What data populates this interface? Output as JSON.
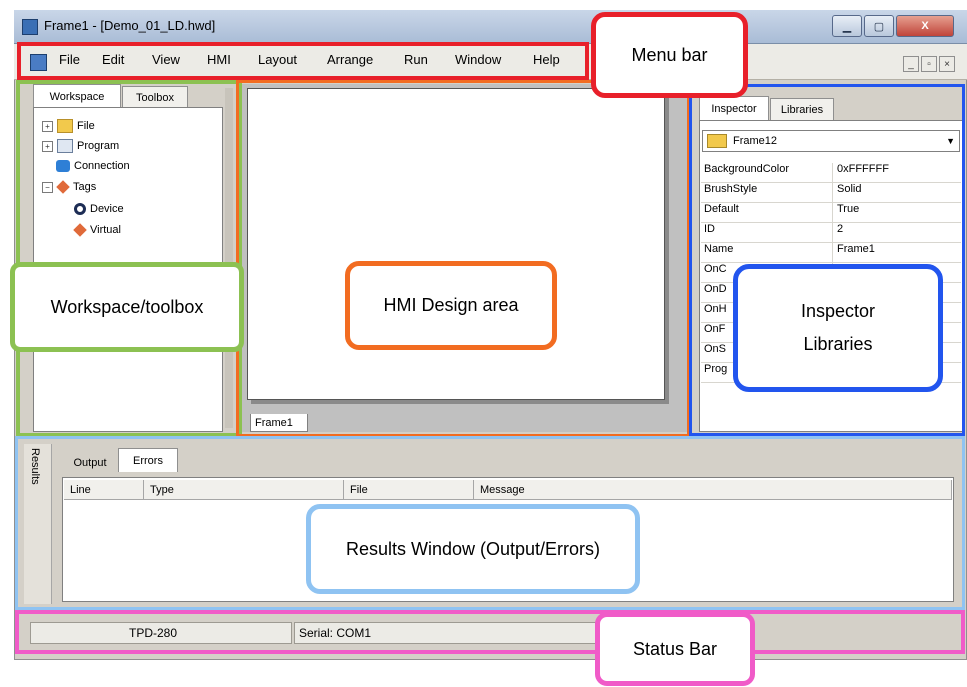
{
  "window": {
    "title": "Frame1 - [Demo_01_LD.hwd]",
    "controls": [
      "▁",
      "▢",
      "X"
    ],
    "mdi_controls": [
      "_",
      "▫",
      "×"
    ]
  },
  "menu": {
    "items": [
      "File",
      "Edit",
      "View",
      "HMI",
      "Layout",
      "Arrange",
      "Run",
      "Window",
      "Help"
    ]
  },
  "workspace": {
    "tabs": [
      "Workspace",
      "Toolbox"
    ],
    "tree": [
      {
        "label": "File",
        "icon": "folder-icon",
        "exp": "+"
      },
      {
        "label": "Program",
        "icon": "program-icon",
        "exp": "+"
      },
      {
        "label": "Connection",
        "icon": "connection-icon",
        "exp": ""
      },
      {
        "label": "Tags",
        "icon": "tags-icon",
        "exp": "−"
      },
      {
        "label": "Device",
        "icon": "device-icon",
        "exp": ""
      },
      {
        "label": "Virtual",
        "icon": "virtual-icon",
        "exp": ""
      }
    ]
  },
  "design": {
    "frame_tab": "Frame1"
  },
  "inspector": {
    "tabs": [
      "Inspector",
      "Libraries"
    ],
    "selected_object": "Frame12",
    "properties": [
      {
        "name": "BackgroundColor",
        "value": "0xFFFFFF"
      },
      {
        "name": "BrushStyle",
        "value": "Solid"
      },
      {
        "name": "Default",
        "value": "True"
      },
      {
        "name": "ID",
        "value": "2"
      },
      {
        "name": "Name",
        "value": "Frame1"
      },
      {
        "name": "OnC",
        "value": ""
      },
      {
        "name": "OnD",
        "value": ""
      },
      {
        "name": "OnH",
        "value": ""
      },
      {
        "name": "OnF",
        "value": ""
      },
      {
        "name": "OnS",
        "value": ""
      },
      {
        "name": "Prog",
        "value": ""
      }
    ]
  },
  "results": {
    "side_label": "Results",
    "tabs": [
      "Output",
      "Errors"
    ],
    "columns": [
      "Line",
      "Type",
      "File",
      "Message"
    ]
  },
  "status": {
    "cells": [
      "TPD-280",
      "Serial: COM1"
    ]
  },
  "annotations": {
    "menu_bar": "Menu bar",
    "workspace": "Workspace/toolbox",
    "design": "HMI Design area",
    "inspector_line1": "Inspector",
    "inspector_line2": "Libraries",
    "results": "Results Window (Output/Errors)",
    "status": "Status Bar"
  },
  "colors": {
    "menu_frame": "#e8202a",
    "workspace_frame": "#8cc152",
    "design_frame": "#f26c21",
    "inspector_frame": "#2255ee",
    "results_frame": "#8fc3f2",
    "status_frame": "#f05bc8"
  }
}
